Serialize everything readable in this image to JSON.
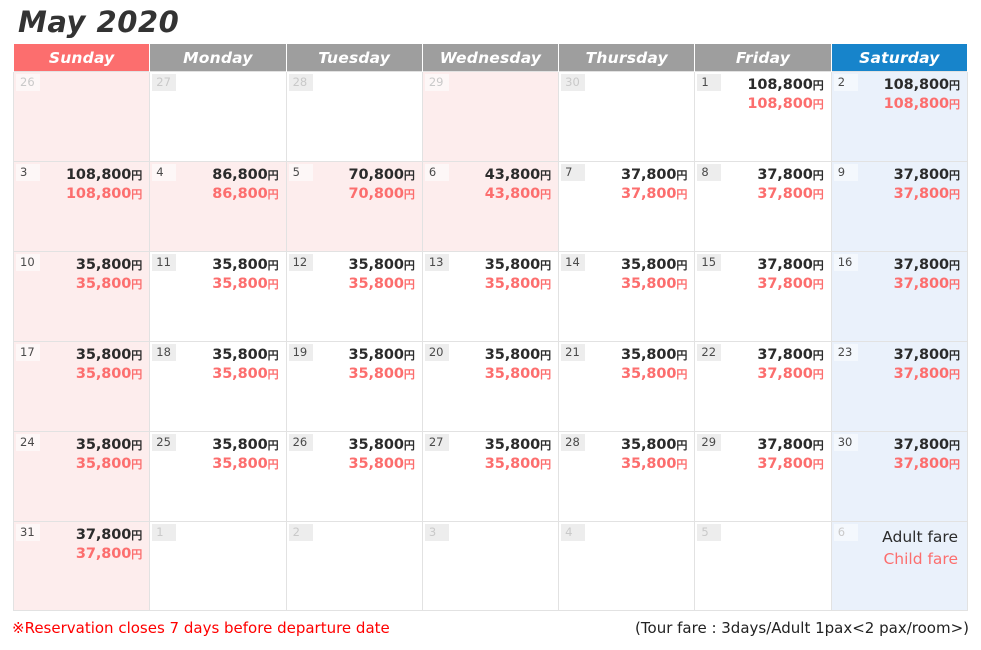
{
  "title": "May 2020",
  "currency_symbol": "円",
  "colors": {
    "sunday_header": "#fc6e6e",
    "saturday_header": "#1784cb",
    "weekday_header": "#9e9e9e",
    "holiday_cell": "#fdeded",
    "saturday_cell": "#eaf1fb",
    "adult_fare_text": "#2b2b2b",
    "child_fare_text": "#fc6e6e",
    "footer_note_text": "#ff0000"
  },
  "weekdays": [
    {
      "label": "Sunday",
      "kind": "sun"
    },
    {
      "label": "Monday",
      "kind": "weekday"
    },
    {
      "label": "Tuesday",
      "kind": "weekday"
    },
    {
      "label": "Wednesday",
      "kind": "weekday"
    },
    {
      "label": "Thursday",
      "kind": "weekday"
    },
    {
      "label": "Friday",
      "kind": "weekday"
    },
    {
      "label": "Saturday",
      "kind": "sat"
    }
  ],
  "legend": {
    "adult": "Adult fare",
    "child": "Child fare"
  },
  "footer": {
    "note": "※Reservation closes 7 days before departure date",
    "fare_note": "(Tour fare : 3days/Adult 1pax<2 pax/room>)"
  },
  "weeks": [
    [
      {
        "day": "26",
        "outside": true,
        "bg": "pink",
        "adult": "",
        "child": ""
      },
      {
        "day": "27",
        "outside": true,
        "bg": "white",
        "adult": "",
        "child": ""
      },
      {
        "day": "28",
        "outside": true,
        "bg": "white",
        "adult": "",
        "child": ""
      },
      {
        "day": "29",
        "outside": true,
        "bg": "pink",
        "adult": "",
        "child": ""
      },
      {
        "day": "30",
        "outside": true,
        "bg": "white",
        "adult": "",
        "child": ""
      },
      {
        "day": "1",
        "outside": false,
        "bg": "white",
        "adult": "108,800",
        "child": "108,800"
      },
      {
        "day": "2",
        "outside": false,
        "bg": "blue",
        "adult": "108,800",
        "child": "108,800"
      }
    ],
    [
      {
        "day": "3",
        "outside": false,
        "bg": "pink",
        "adult": "108,800",
        "child": "108,800"
      },
      {
        "day": "4",
        "outside": false,
        "bg": "pink",
        "adult": "86,800",
        "child": "86,800"
      },
      {
        "day": "5",
        "outside": false,
        "bg": "pink",
        "adult": "70,800",
        "child": "70,800"
      },
      {
        "day": "6",
        "outside": false,
        "bg": "pink",
        "adult": "43,800",
        "child": "43,800"
      },
      {
        "day": "7",
        "outside": false,
        "bg": "white",
        "adult": "37,800",
        "child": "37,800"
      },
      {
        "day": "8",
        "outside": false,
        "bg": "white",
        "adult": "37,800",
        "child": "37,800"
      },
      {
        "day": "9",
        "outside": false,
        "bg": "blue",
        "adult": "37,800",
        "child": "37,800"
      }
    ],
    [
      {
        "day": "10",
        "outside": false,
        "bg": "pink",
        "adult": "35,800",
        "child": "35,800"
      },
      {
        "day": "11",
        "outside": false,
        "bg": "white",
        "adult": "35,800",
        "child": "35,800"
      },
      {
        "day": "12",
        "outside": false,
        "bg": "white",
        "adult": "35,800",
        "child": "35,800"
      },
      {
        "day": "13",
        "outside": false,
        "bg": "white",
        "adult": "35,800",
        "child": "35,800"
      },
      {
        "day": "14",
        "outside": false,
        "bg": "white",
        "adult": "35,800",
        "child": "35,800"
      },
      {
        "day": "15",
        "outside": false,
        "bg": "white",
        "adult": "37,800",
        "child": "37,800"
      },
      {
        "day": "16",
        "outside": false,
        "bg": "blue",
        "adult": "37,800",
        "child": "37,800"
      }
    ],
    [
      {
        "day": "17",
        "outside": false,
        "bg": "pink",
        "adult": "35,800",
        "child": "35,800"
      },
      {
        "day": "18",
        "outside": false,
        "bg": "white",
        "adult": "35,800",
        "child": "35,800"
      },
      {
        "day": "19",
        "outside": false,
        "bg": "white",
        "adult": "35,800",
        "child": "35,800"
      },
      {
        "day": "20",
        "outside": false,
        "bg": "white",
        "adult": "35,800",
        "child": "35,800"
      },
      {
        "day": "21",
        "outside": false,
        "bg": "white",
        "adult": "35,800",
        "child": "35,800"
      },
      {
        "day": "22",
        "outside": false,
        "bg": "white",
        "adult": "37,800",
        "child": "37,800"
      },
      {
        "day": "23",
        "outside": false,
        "bg": "blue",
        "adult": "37,800",
        "child": "37,800"
      }
    ],
    [
      {
        "day": "24",
        "outside": false,
        "bg": "pink",
        "adult": "35,800",
        "child": "35,800"
      },
      {
        "day": "25",
        "outside": false,
        "bg": "white",
        "adult": "35,800",
        "child": "35,800"
      },
      {
        "day": "26",
        "outside": false,
        "bg": "white",
        "adult": "35,800",
        "child": "35,800"
      },
      {
        "day": "27",
        "outside": false,
        "bg": "white",
        "adult": "35,800",
        "child": "35,800"
      },
      {
        "day": "28",
        "outside": false,
        "bg": "white",
        "adult": "35,800",
        "child": "35,800"
      },
      {
        "day": "29",
        "outside": false,
        "bg": "white",
        "adult": "37,800",
        "child": "37,800"
      },
      {
        "day": "30",
        "outside": false,
        "bg": "blue",
        "adult": "37,800",
        "child": "37,800"
      }
    ],
    [
      {
        "day": "31",
        "outside": false,
        "bg": "pink",
        "adult": "37,800",
        "child": "37,800"
      },
      {
        "day": "1",
        "outside": true,
        "bg": "white",
        "adult": "",
        "child": ""
      },
      {
        "day": "2",
        "outside": true,
        "bg": "white",
        "adult": "",
        "child": ""
      },
      {
        "day": "3",
        "outside": true,
        "bg": "white",
        "adult": "",
        "child": ""
      },
      {
        "day": "4",
        "outside": true,
        "bg": "white",
        "adult": "",
        "child": ""
      },
      {
        "day": "5",
        "outside": true,
        "bg": "white",
        "adult": "",
        "child": ""
      },
      {
        "day": "6",
        "outside": true,
        "bg": "blue",
        "adult": "",
        "child": "",
        "legend": true
      }
    ]
  ]
}
